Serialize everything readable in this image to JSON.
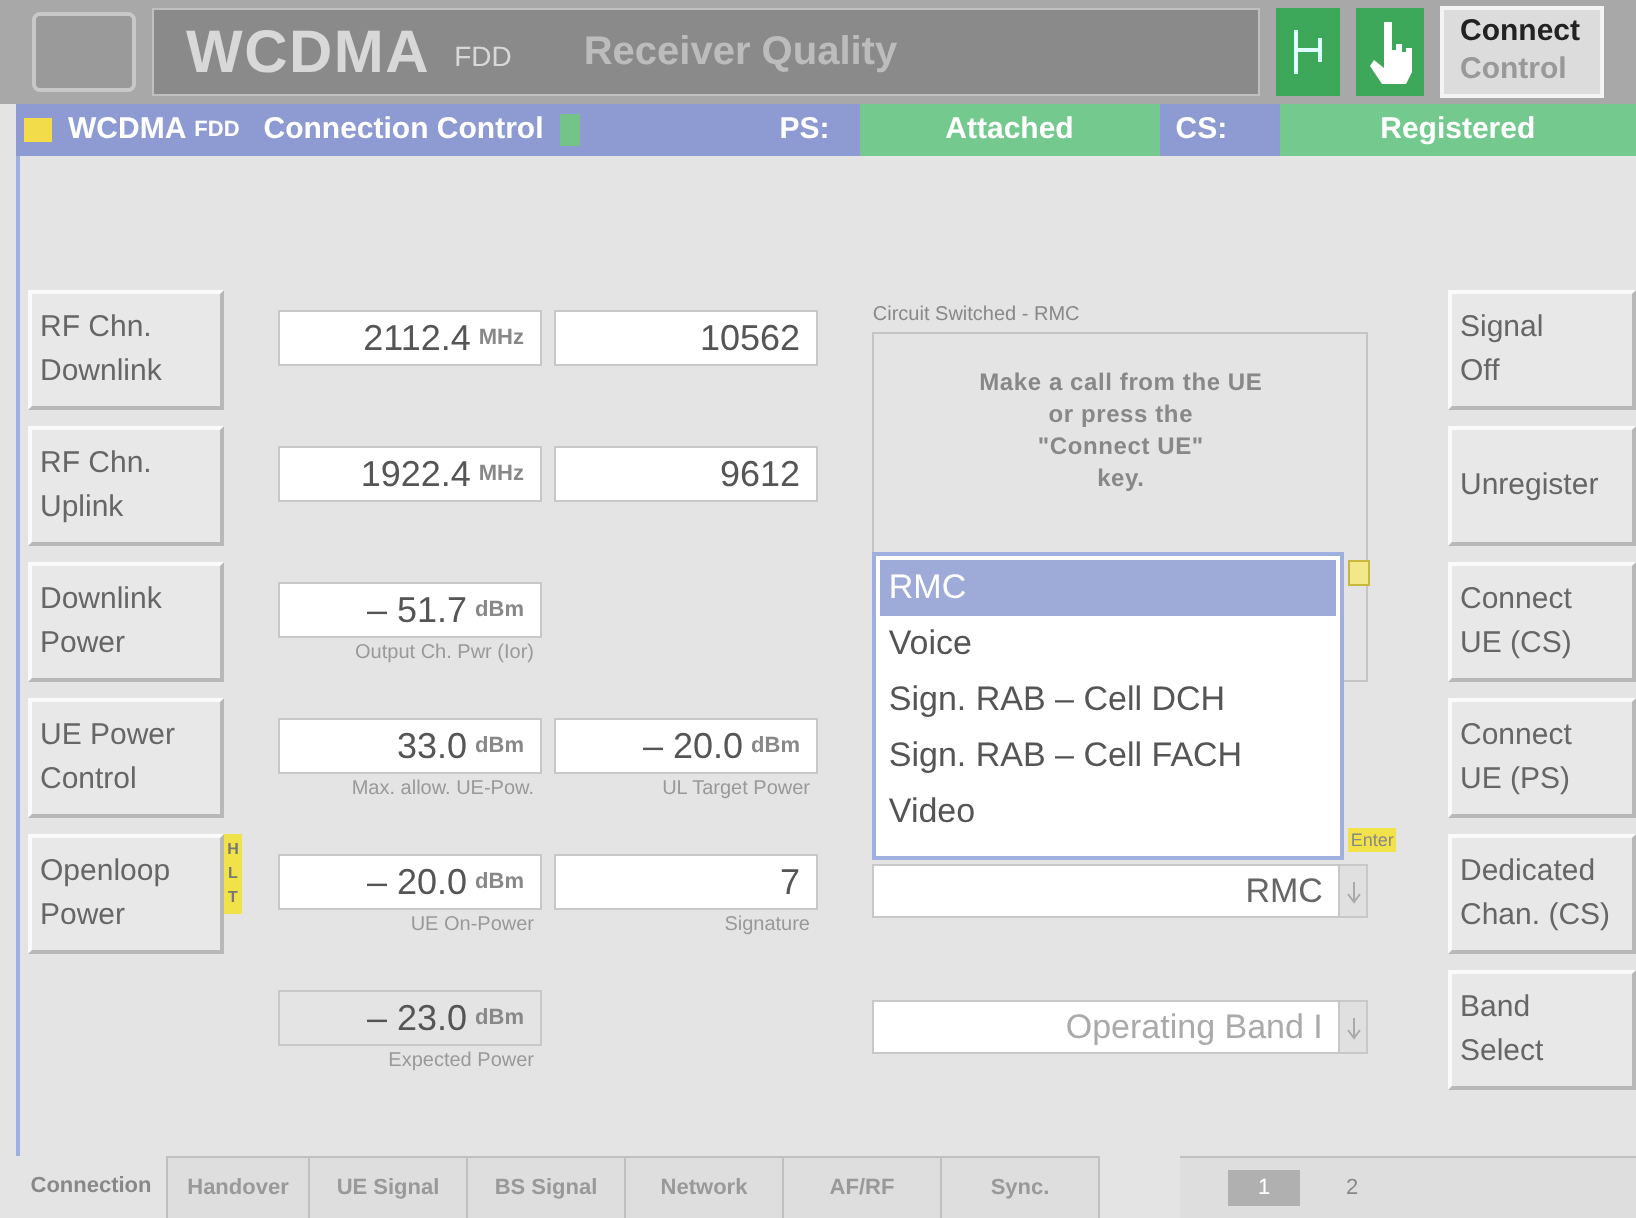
{
  "top_bar": {
    "title": "WCDMA",
    "title_suffix": "FDD",
    "subtitle": "Receiver Quality",
    "connect_button": [
      "Connect",
      "Control"
    ]
  },
  "header": {
    "title": "WCDMA",
    "title_suffix": "FDD",
    "subtitle": "Connection Control",
    "ps_label": "PS:",
    "ps_value": "Attached",
    "cs_label": "CS:",
    "cs_value": "Registered"
  },
  "left_rows": [
    {
      "button": [
        "RF Chn.",
        "Downlink"
      ],
      "fields": [
        {
          "value": "2112.4",
          "unit": "MHz",
          "kind": "edit"
        },
        {
          "value": "10562",
          "kind": "edit"
        }
      ]
    },
    {
      "button": [
        "RF Chn.",
        "Uplink"
      ],
      "fields": [
        {
          "value": "1922.4",
          "unit": "MHz",
          "kind": "edit"
        },
        {
          "value": "9612",
          "kind": "edit"
        }
      ]
    },
    {
      "button": [
        "Downlink",
        "Power"
      ],
      "fields": [
        {
          "value": "– 51.7",
          "unit": "dBm",
          "caption": "Output Ch. Pwr (Ior)",
          "kind": "edit"
        }
      ]
    },
    {
      "button": [
        "UE Power",
        "Control"
      ],
      "fields": [
        {
          "value": "33.0",
          "unit": "dBm",
          "caption": "Max. allow. UE-Pow.",
          "kind": "edit"
        },
        {
          "value": "– 20.0",
          "unit": "dBm",
          "caption": "UL Target Power",
          "kind": "edit"
        }
      ]
    },
    {
      "button": [
        "Openloop",
        "Power"
      ],
      "hlt_tag": [
        "H",
        "L",
        "T"
      ],
      "fields": [
        {
          "value": "– 20.0",
          "unit": "dBm",
          "caption": "UE On-Power",
          "kind": "edit"
        },
        {
          "value": "7",
          "caption": "Signature",
          "kind": "edit"
        }
      ]
    },
    {
      "fields": [
        {
          "value": "– 23.0",
          "unit": "dBm",
          "caption": "Expected Power",
          "kind": "readonly"
        }
      ]
    }
  ],
  "middle": {
    "section_label": "Circuit Switched - RMC",
    "message": [
      "Make a call from the UE",
      "or press the",
      "\"Connect UE\"",
      "key."
    ],
    "list": [
      {
        "label": "RMC",
        "selected": true
      },
      {
        "label": "Voice",
        "selected": false
      },
      {
        "label": "Sign. RAB – Cell DCH",
        "selected": false
      },
      {
        "label": "Sign. RAB – Cell FACH",
        "selected": false
      },
      {
        "label": "Video",
        "selected": false
      }
    ],
    "enter_tag": "Enter",
    "selects": [
      {
        "value": "RMC",
        "disabled": false
      },
      {
        "value": "Operating Band I",
        "disabled": true
      }
    ]
  },
  "right_buttons": [
    [
      "Signal",
      "Off"
    ],
    [
      "Unregister"
    ],
    [
      "Connect",
      "UE (CS)"
    ],
    [
      "Connect",
      "UE (PS)"
    ],
    [
      "Dedicated",
      "Chan. (CS)"
    ],
    [
      "Band",
      "Select"
    ]
  ],
  "tabs": [
    {
      "label": "Connection",
      "selected": true
    },
    {
      "label": "Handover",
      "selected": false
    },
    {
      "label": "UE Signal",
      "selected": false
    },
    {
      "label": "BS Signal",
      "selected": false
    },
    {
      "label": "Network",
      "selected": false
    },
    {
      "label": "AF/RF",
      "selected": false
    },
    {
      "label": "Sync.",
      "selected": false
    }
  ],
  "pages": [
    {
      "label": "1",
      "selected": true
    },
    {
      "label": "2",
      "selected": false
    }
  ]
}
